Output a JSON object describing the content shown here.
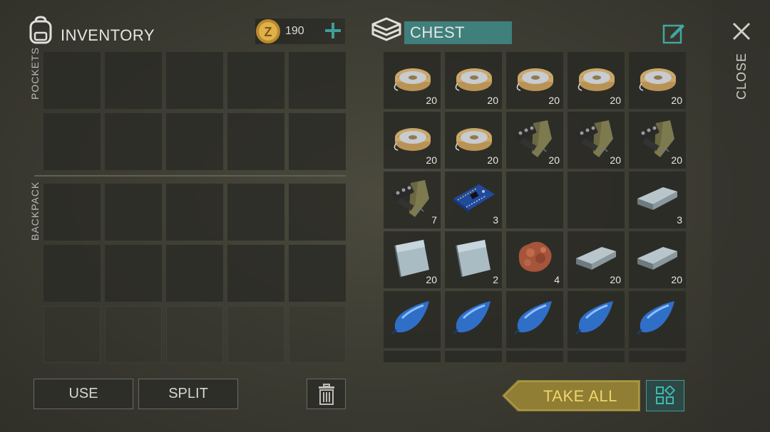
{
  "inventory": {
    "title": "INVENTORY",
    "coins": "190",
    "pockets_label": "POCKETS",
    "backpack_label": "BACKPACK"
  },
  "chest": {
    "title": "CHEST",
    "items": [
      {
        "icon": "wire-spool-icon",
        "qty": "20"
      },
      {
        "icon": "wire-spool-icon",
        "qty": "20"
      },
      {
        "icon": "wire-spool-icon",
        "qty": "20"
      },
      {
        "icon": "wire-spool-icon",
        "qty": "20"
      },
      {
        "icon": "wire-spool-icon",
        "qty": "20"
      },
      {
        "icon": "wire-spool-icon",
        "qty": "20"
      },
      {
        "icon": "wire-spool-icon",
        "qty": "20"
      },
      {
        "icon": "gun-parts-icon",
        "qty": "20"
      },
      {
        "icon": "gun-parts-icon",
        "qty": "20"
      },
      {
        "icon": "gun-parts-icon",
        "qty": "20"
      },
      {
        "icon": "gun-parts-icon",
        "qty": "7"
      },
      {
        "icon": "circuit-board-icon",
        "qty": "3"
      },
      {
        "icon": "",
        "qty": ""
      },
      {
        "icon": "",
        "qty": ""
      },
      {
        "icon": "metal-ingot-icon",
        "qty": "3"
      },
      {
        "icon": "metal-plate-icon",
        "qty": "20"
      },
      {
        "icon": "metal-plate-icon",
        "qty": "2"
      },
      {
        "icon": "copper-ore-icon",
        "qty": "4"
      },
      {
        "icon": "metal-ingot-icon",
        "qty": "20"
      },
      {
        "icon": "metal-ingot-icon",
        "qty": "20"
      },
      {
        "icon": "blue-drop-icon",
        "qty": ""
      },
      {
        "icon": "blue-drop-icon",
        "qty": ""
      },
      {
        "icon": "blue-drop-icon",
        "qty": ""
      },
      {
        "icon": "blue-drop-icon",
        "qty": ""
      },
      {
        "icon": "blue-drop-icon",
        "qty": ""
      }
    ]
  },
  "buttons": {
    "use": "USE",
    "split": "SPLIT",
    "take_all": "TAKE ALL",
    "close": "CLOSE"
  },
  "colors": {
    "accent_teal": "#3f7f7c",
    "take_all_gold": "#8f7e34",
    "take_all_text": "#f0d36a"
  }
}
